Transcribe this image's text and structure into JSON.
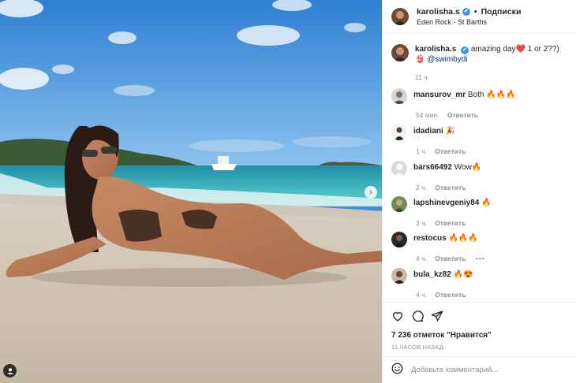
{
  "post": {
    "author": "karolisha.s",
    "verified_mark": "✔",
    "separator": "•",
    "follow_label": "Подписки",
    "location": "Eden Rock - St Barths",
    "image_description_icon": "beach-photo",
    "next_icon": "chevron-right-icon",
    "tag_icon": "user-tag-icon"
  },
  "caption": {
    "author": "karolisha.s",
    "verified_mark": "✔",
    "text": "amazing day❤️ 1 or 2??)",
    "mention_prefix": "👙",
    "mention": "@swimbydi",
    "time": "11 ч."
  },
  "comments": [
    {
      "user": "mansurov_mr",
      "text": "Both 🔥🔥🔥",
      "time": "54 мин.",
      "reply": "Ответить"
    },
    {
      "user": "idadiani",
      "text": "🎉",
      "time": "1 ч.",
      "reply": "Ответить"
    },
    {
      "user": "bars66492",
      "text": "Wow🔥",
      "time": "2 ч.",
      "reply": "Ответить"
    },
    {
      "user": "lapshinevgeniy84",
      "text": "🔥",
      "time": "3 ч.",
      "reply": "Ответить"
    },
    {
      "user": "restocus",
      "text": "🔥🔥🔥",
      "time": "4 ч.",
      "reply": "Ответить",
      "more": "•••"
    },
    {
      "user": "bula_kz82",
      "text": "🔥😍",
      "time": "4 ч.",
      "reply": "Ответить"
    }
  ],
  "actions": {
    "like_icon": "heart-icon",
    "comment_icon": "comment-icon",
    "share_icon": "share-icon",
    "likes_text": "7 236 отметок \"Нравится\"",
    "timestamp": "11 ЧАСОВ НАЗАД"
  },
  "add_comment": {
    "emoji_icon": "smile-icon",
    "placeholder": "Добавьте комментарий..."
  },
  "colors": {
    "text": "#262626",
    "muted": "#8e8e8e",
    "verified": "#3897f0",
    "mention": "#00376b",
    "border": "#efefef"
  }
}
